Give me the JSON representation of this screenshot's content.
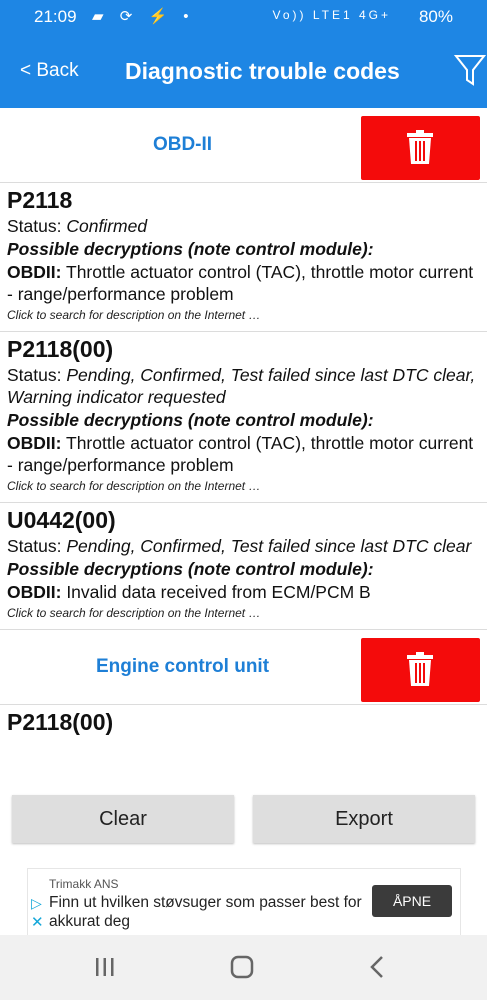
{
  "status_bar": {
    "time": "21:09",
    "signal_label": "Vo)) LTE1 4G+",
    "battery": "80%"
  },
  "app_bar": {
    "back_label": "< Back",
    "title": "Diagnostic trouble codes",
    "filter_icon": "filter-icon"
  },
  "groups": [
    {
      "name": "OBD-II",
      "dtcs": [
        {
          "code": "P2118",
          "status_label": "Status: ",
          "status_value": "Confirmed",
          "possible": "Possible decryptions (note control module):",
          "desc_prefix": "OBDII:",
          "desc_text": " Throttle actuator control (TAC), throttle motor current - range/performance problem",
          "hint": "Click to search for description on the Internet …"
        },
        {
          "code": "P2118(00)",
          "status_label": "Status: ",
          "status_value": "Pending, Confirmed, Test failed since last DTC clear, Warning indicator requested",
          "possible": "Possible decryptions (note control module):",
          "desc_prefix": "OBDII:",
          "desc_text": " Throttle actuator control (TAC), throttle motor current - range/performance problem",
          "hint": "Click to search for description on the Internet …"
        },
        {
          "code": "U0442(00)",
          "status_label": "Status: ",
          "status_value": "Pending, Confirmed, Test failed since last DTC clear",
          "possible": "Possible decryptions (note control module):",
          "desc_prefix": "OBDII:",
          "desc_text": " Invalid data received from ECM/PCM B",
          "hint": "Click to search for description on the Internet …"
        }
      ]
    },
    {
      "name": "Engine control unit",
      "partial_code": "P2118(00)"
    }
  ],
  "actions": {
    "clear_label": "Clear",
    "export_label": "Export"
  },
  "ad": {
    "advertiser": "Trimakk ANS",
    "text": "Finn ut hvilken støvsuger som passer best for akkurat deg",
    "cta": "ÅPNE"
  },
  "colors": {
    "primary": "#1e86e4",
    "delete": "#f40b0b",
    "group_text": "#1e7fd6"
  }
}
